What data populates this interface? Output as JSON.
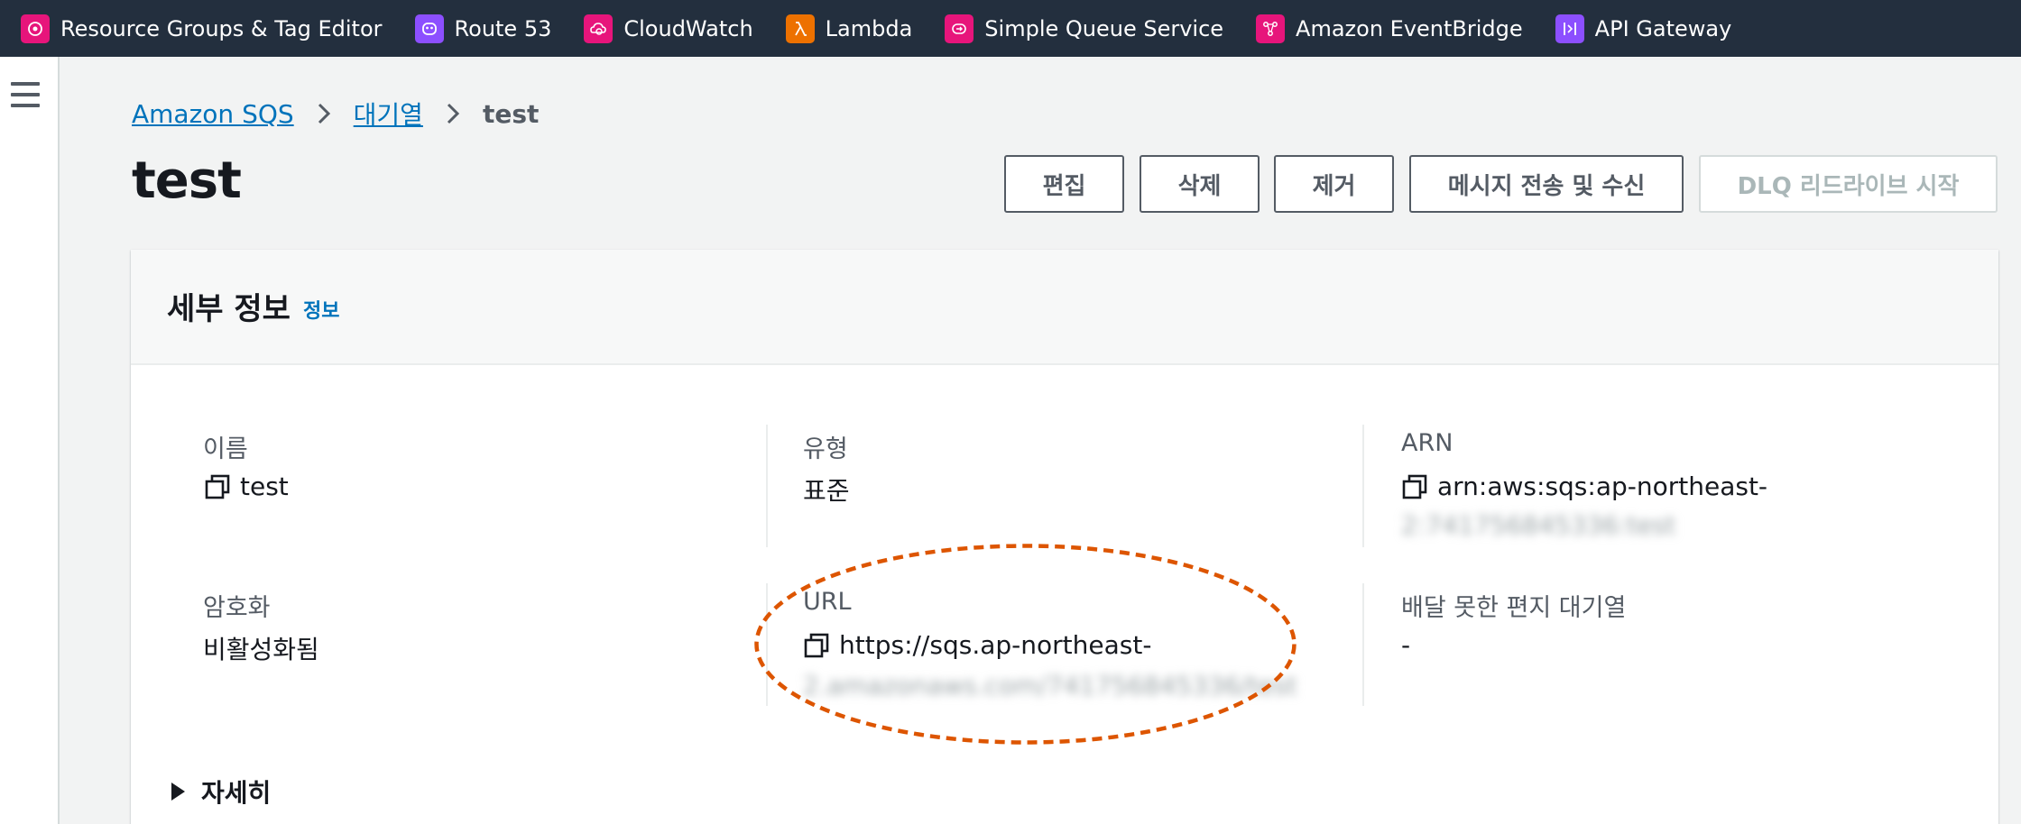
{
  "topbar": {
    "favorites": [
      {
        "label": "Resource Groups & Tag Editor",
        "icon": "resource-groups-icon",
        "color": "#e7157b"
      },
      {
        "label": "Route 53",
        "icon": "route53-icon",
        "color": "#8c4fff"
      },
      {
        "label": "CloudWatch",
        "icon": "cloudwatch-icon",
        "color": "#e7157b"
      },
      {
        "label": "Lambda",
        "icon": "lambda-icon",
        "color": "#ed7100"
      },
      {
        "label": "Simple Queue Service",
        "icon": "sqs-icon",
        "color": "#e7157b"
      },
      {
        "label": "Amazon EventBridge",
        "icon": "eventbridge-icon",
        "color": "#e7157b"
      },
      {
        "label": "API Gateway",
        "icon": "api-gateway-icon",
        "color": "#8c4fff"
      }
    ]
  },
  "breadcrumb": {
    "items": [
      "Amazon SQS",
      "대기열",
      "test"
    ]
  },
  "page": {
    "title": "test"
  },
  "actions": {
    "edit": "편집",
    "delete": "삭제",
    "purge": "제거",
    "send_receive": "메시지 전송 및 수신",
    "dlq_redrive": "DLQ 리드라이브 시작"
  },
  "details": {
    "title": "세부 정보",
    "info_link": "정보",
    "name_label": "이름",
    "name_value": "test",
    "type_label": "유형",
    "type_value": "표준",
    "arn_label": "ARN",
    "arn_value": "arn:aws:sqs:ap-northeast-",
    "arn_value_redacted": "2:741756845336:test",
    "encryption_label": "암호화",
    "encryption_value": "비활성화됨",
    "url_label": "URL",
    "url_value": "https://sqs.ap-northeast-",
    "url_value_redacted": "2.amazonaws.com/741756845336/test",
    "dlq_label": "배달 못한 편지 대기열",
    "dlq_value": "-",
    "more_label": "자세히"
  },
  "colors": {
    "topbar_bg": "#232f3e",
    "link": "#0073bb",
    "annotation": "#dd5500"
  }
}
